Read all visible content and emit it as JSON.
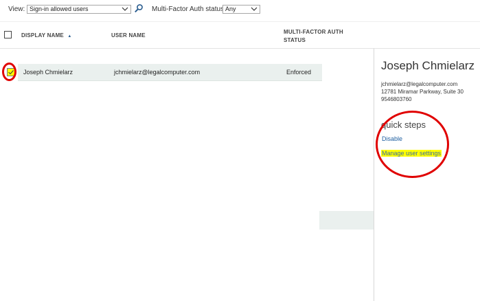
{
  "toolbar": {
    "view_label": "View:",
    "view_value": "Sign-in allowed users",
    "mfa_status_label": "Multi-Factor Auth status:",
    "mfa_status_value": "Any"
  },
  "table": {
    "columns": {
      "display_name": "DISPLAY NAME",
      "user_name": "USER NAME",
      "mfa_status_line1": "MULTI-FACTOR AUTH",
      "mfa_status_line2": "STATUS"
    },
    "rows": [
      {
        "display_name": "Joseph Chmielarz",
        "user_name": "jchmielarz@legalcomputer.com",
        "mfa_status": "Enforced",
        "selected": true
      }
    ]
  },
  "detail_pane": {
    "name": "Joseph Chmielarz",
    "email": "jchmielarz@legalcomputer.com",
    "address": "12781 Miramar Parkway, Suite 30",
    "phone": "9546803760",
    "quick_steps_title": "quick steps",
    "disable_link": "Disable",
    "manage_link": "Manage user settings"
  },
  "colors": {
    "highlight": "#ffff00",
    "annotation_red": "#e00000",
    "link_blue": "#1f5fa0",
    "row_selected": "#eaf0ee"
  },
  "icons": {
    "search": "search-icon",
    "dropdown": "chevron-down-icon",
    "sort": "sort-ascending-icon",
    "checkbox": "checkbox-icon"
  }
}
